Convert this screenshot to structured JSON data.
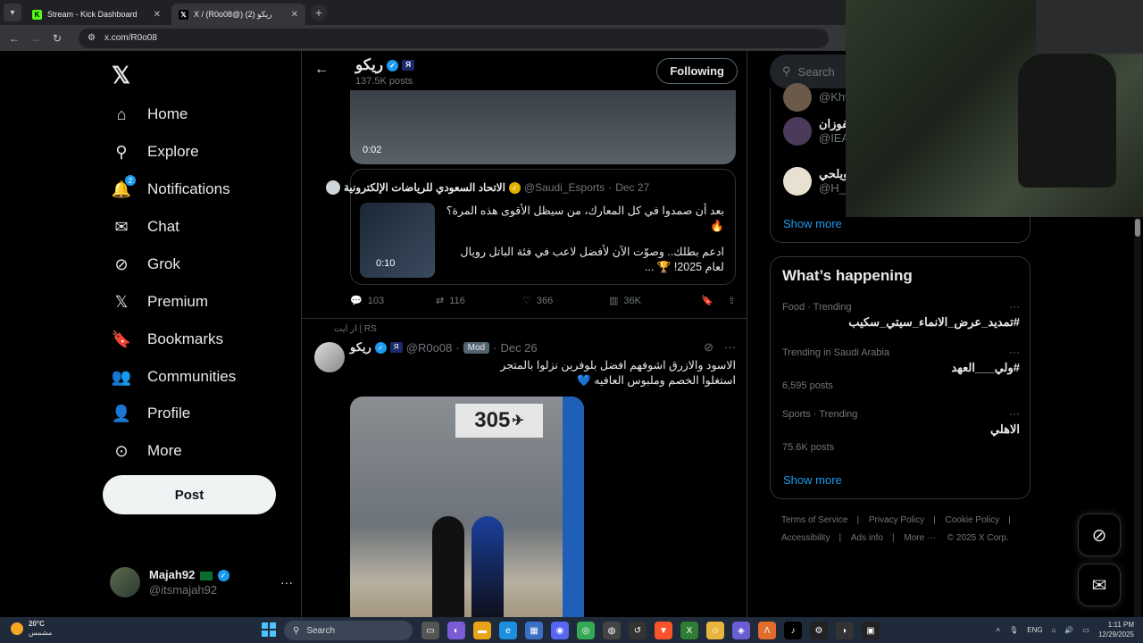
{
  "browser": {
    "tabs": [
      {
        "title": "Stream - Kick Dashboard",
        "favicon": "K"
      },
      {
        "title": "X / (R0o08@) ريكو (2)",
        "favicon": "𝕏"
      }
    ],
    "url": "x.com/R0o08"
  },
  "nav": {
    "items": [
      {
        "label": "Home",
        "icon": "home-icon",
        "glyph": "⌂"
      },
      {
        "label": "Explore",
        "icon": "search-icon",
        "glyph": "⚲"
      },
      {
        "label": "Notifications",
        "icon": "bell-icon",
        "glyph": "🔔",
        "badge": "2"
      },
      {
        "label": "Chat",
        "icon": "mail-icon",
        "glyph": "✉"
      },
      {
        "label": "Grok",
        "icon": "grok-icon",
        "glyph": "⊘"
      },
      {
        "label": "Premium",
        "icon": "x-icon",
        "glyph": "𝕏"
      },
      {
        "label": "Bookmarks",
        "icon": "bookmark-icon",
        "glyph": "🔖"
      },
      {
        "label": "Communities",
        "icon": "people-icon",
        "glyph": "👥"
      },
      {
        "label": "Profile",
        "icon": "person-icon",
        "glyph": "👤"
      },
      {
        "label": "More",
        "icon": "more-circle-icon",
        "glyph": "⊙"
      }
    ],
    "post_label": "Post",
    "account": {
      "name": "Majah92",
      "handle": "@itsmajah92"
    }
  },
  "profile_header": {
    "name": "ريكو",
    "posts": "137.5K posts",
    "following_label": "Following"
  },
  "tweet1": {
    "video_time": "0:02",
    "quote": {
      "name": "الاتحاد السعودي للرياضات الإلكترونية",
      "handle": "@Saudi_Esports",
      "date": "Dec 27",
      "thumb_time": "0:10",
      "line1": "بعد أن صمدوا في كل المعارك، من سيظل الأقوى هذه المرة؟",
      "emoji1": "🔥",
      "line2": "ادعم بطلك.. وصوّت الآن لأفضل لاعب في فئة الباتل رويال لعام 2025! 🏆 ..."
    },
    "actions": {
      "replies": "103",
      "reposts": "116",
      "likes": "366",
      "views": "36K"
    }
  },
  "tweet2": {
    "repost_label": "RS | ار ايت",
    "name": "ريكو",
    "handle": "@R0o08",
    "mod_label": "Mod",
    "date": "Dec 26",
    "line1": "الاسود والازرق اشوفهم افضل بلوفرين نزلوا بالمتجر",
    "line2": "استغلوا الخصم وملبوس العافيه 💙",
    "sign_text": "305"
  },
  "right": {
    "search_placeholder": "Search",
    "who_follow": [
      {
        "name": "",
        "handle": "@Khw"
      },
      {
        "name": "لفوزان",
        "handle": "@IEA"
      },
      {
        "name": "ويلحي",
        "handle": "@H_s"
      }
    ],
    "show_more": "Show more",
    "happening_title": "What’s happening",
    "trends": [
      {
        "category": "Food · Trending",
        "title": "#تمديد_عرض_الانماء_سيتي_سكيب",
        "count": ""
      },
      {
        "category": "Trending in Saudi Arabia",
        "title": "#ولي___العهد",
        "count": "6,595 posts"
      },
      {
        "category": "Sports · Trending",
        "title": "الاهلي",
        "count": "75.6K posts"
      }
    ],
    "footer": [
      "Terms of Service",
      "Privacy Policy",
      "Cookie Policy",
      "Accessibility",
      "Ads info",
      "More ···",
      "© 2025 X Corp."
    ]
  },
  "taskbar": {
    "temp": "20°C",
    "weather_desc": "مشمس",
    "search_label": "Search",
    "lang": "ENG",
    "time": "1:11 PM",
    "date": "12/29/2025"
  }
}
